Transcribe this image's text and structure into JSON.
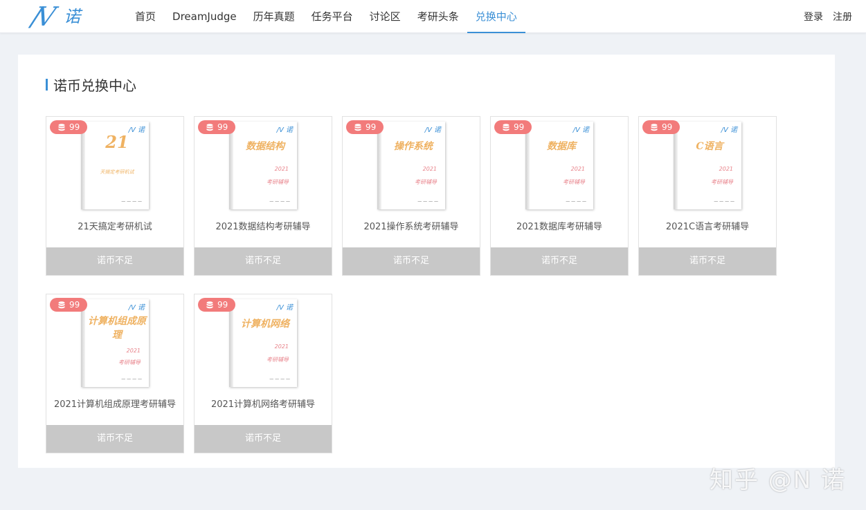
{
  "logo": {
    "mark": "/V",
    "text": "诺"
  },
  "nav": [
    {
      "label": "首页"
    },
    {
      "label": "DreamJudge"
    },
    {
      "label": "历年真题"
    },
    {
      "label": "任务平台"
    },
    {
      "label": "讨论区"
    },
    {
      "label": "考研头条"
    },
    {
      "label": "兑换中心"
    }
  ],
  "auth": {
    "login": "登录",
    "register": "注册"
  },
  "section_title": "诺币兑换中心",
  "products": [
    {
      "price": "99",
      "name": "21天搞定考研机试",
      "cover_title": "21",
      "cover_line": "天搞定考研机试",
      "button": "诺币不足"
    },
    {
      "price": "99",
      "name": "2021数据结构考研辅导",
      "cover_title": "数据结构",
      "cover_year": "2021",
      "cover_sub": "考研辅导",
      "button": "诺币不足"
    },
    {
      "price": "99",
      "name": "2021操作系统考研辅导",
      "cover_title": "操作系统",
      "cover_year": "2021",
      "cover_sub": "考研辅导",
      "button": "诺币不足"
    },
    {
      "price": "99",
      "name": "2021数据库考研辅导",
      "cover_title": "数据库",
      "cover_year": "2021",
      "cover_sub": "考研辅导",
      "button": "诺币不足"
    },
    {
      "price": "99",
      "name": "2021C语言考研辅导",
      "cover_title": "C语言",
      "cover_year": "2021",
      "cover_sub": "考研辅导",
      "button": "诺币不足"
    },
    {
      "price": "99",
      "name": "2021计算机组成原理考研辅导",
      "cover_title": "计算机组成原理",
      "cover_year": "2021",
      "cover_sub": "考研辅导",
      "button": "诺币不足"
    },
    {
      "price": "99",
      "name": "2021计算机网络考研辅导",
      "cover_title": "计算机网络",
      "cover_year": "2021",
      "cover_sub": "考研辅导",
      "button": "诺币不足"
    }
  ],
  "cover_logo": "/V 诺",
  "watermark": "知乎 @N 诺",
  "colors": {
    "accent": "#3a8fd6",
    "badge": "#f27b7b",
    "disabled_button": "#c8c8c8"
  }
}
